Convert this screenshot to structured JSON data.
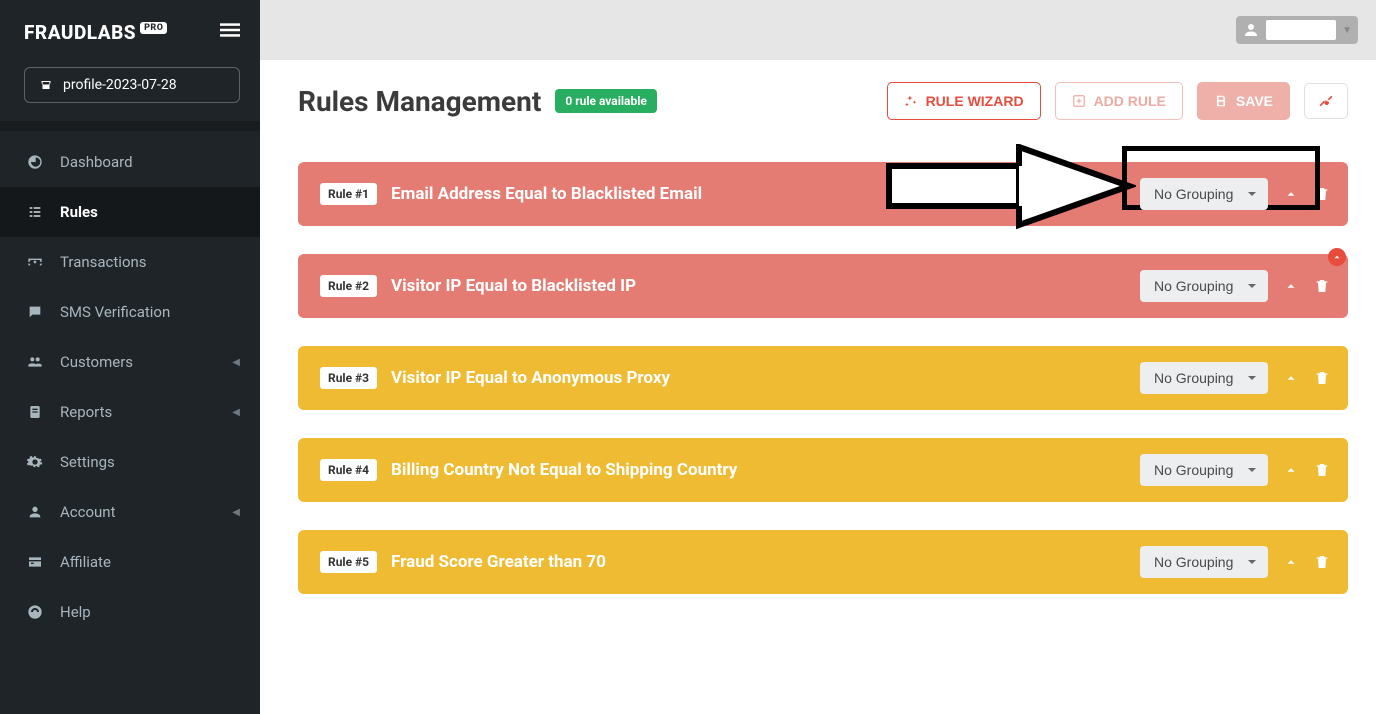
{
  "logo": {
    "main": "FRAUDLABS",
    "badge": "PRO"
  },
  "profile_name": "profile-2023-07-28",
  "sidebar": {
    "items": [
      {
        "label": "Dashboard",
        "active": false,
        "caret": false
      },
      {
        "label": "Rules",
        "active": true,
        "caret": false
      },
      {
        "label": "Transactions",
        "active": false,
        "caret": false
      },
      {
        "label": "SMS Verification",
        "active": false,
        "caret": false
      },
      {
        "label": "Customers",
        "active": false,
        "caret": true
      },
      {
        "label": "Reports",
        "active": false,
        "caret": true
      },
      {
        "label": "Settings",
        "active": false,
        "caret": false
      },
      {
        "label": "Account",
        "active": false,
        "caret": true
      },
      {
        "label": "Affiliate",
        "active": false,
        "caret": false
      },
      {
        "label": "Help",
        "active": false,
        "caret": false
      }
    ]
  },
  "page": {
    "title": "Rules Management",
    "availability_badge": "0 rule available",
    "buttons": {
      "wizard": "RULE WIZARD",
      "add": "ADD RULE",
      "save": "SAVE"
    }
  },
  "grouping_label": "No Grouping",
  "rules": [
    {
      "tag": "Rule #1",
      "title": "Email Address Equal to Blacklisted Email",
      "color": "red"
    },
    {
      "tag": "Rule #2",
      "title": "Visitor IP Equal to Blacklisted IP",
      "color": "red"
    },
    {
      "tag": "Rule #3",
      "title": "Visitor IP Equal to Anonymous Proxy",
      "color": "yellow"
    },
    {
      "tag": "Rule #4",
      "title": "Billing Country Not Equal to Shipping Country",
      "color": "yellow"
    },
    {
      "tag": "Rule #5",
      "title": "Fraud Score Greater than 70",
      "color": "yellow"
    }
  ]
}
